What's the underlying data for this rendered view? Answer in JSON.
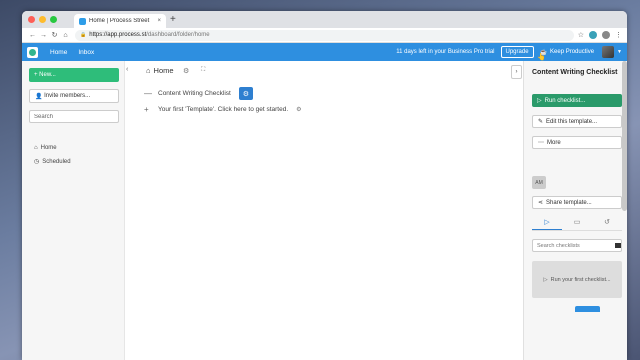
{
  "browser": {
    "tab_title": "Home | Process Street",
    "tab_close": "×",
    "new_tab": "+",
    "url_host": "https://app.process.st",
    "url_path": "/dashboard/folder/home"
  },
  "header": {
    "nav": [
      "Home",
      "Inbox"
    ],
    "trial_text": "11 days left in your Business Pro trial",
    "upgrade_label": "Upgrade",
    "keep_productive_label": "Keep Productive"
  },
  "sidebar": {
    "new_label": "New...",
    "invite_label": "Invite members...",
    "search_placeholder": "Search",
    "items": [
      {
        "label": "Home",
        "icon": "home-icon"
      },
      {
        "label": "Scheduled",
        "icon": "clock-icon"
      }
    ]
  },
  "main": {
    "breadcrumb": "Home",
    "rows": [
      {
        "symbol": "—",
        "label": "Content Writing Checklist"
      },
      {
        "symbol": "+",
        "label": "Your first 'Template'. Click here to get started."
      }
    ]
  },
  "right_panel": {
    "title": "Content Writing Checklist",
    "run_label": "Run checklist...",
    "edit_label": "Edit this template...",
    "more_label": "More",
    "avatar_initials": "AM",
    "share_label": "Share template...",
    "search_placeholder": "Search checklists",
    "empty_label": "Run your first checklist..."
  },
  "colors": {
    "header_blue": "#2e8fe0",
    "new_green": "#2ebd7a",
    "run_green": "#2a9a6a"
  }
}
